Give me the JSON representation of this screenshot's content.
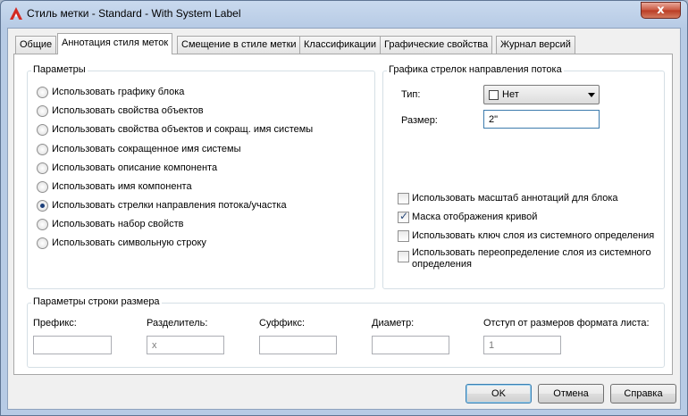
{
  "window": {
    "title": "Стиль метки - Standard - With System Label",
    "close_glyph": "x",
    "icon": "autocad-a-icon"
  },
  "tabs": [
    {
      "label": "Общие",
      "active": false
    },
    {
      "label": "Аннотация стиля меток",
      "active": true
    },
    {
      "label": "Смещение в стиле метки",
      "active": false
    },
    {
      "label": "Классификации",
      "active": false
    },
    {
      "label": "Графические свойства",
      "active": false
    },
    {
      "label": "Журнал версий",
      "active": false
    }
  ],
  "params": {
    "title": "Параметры",
    "options": [
      {
        "label": "Использовать графику блока",
        "checked": false
      },
      {
        "label": "Использовать свойства объектов",
        "checked": false
      },
      {
        "label": "Использовать свойства объектов и сокращ. имя системы",
        "checked": false
      },
      {
        "label": "Использовать сокращенное имя системы",
        "checked": false
      },
      {
        "label": "Использовать описание компонента",
        "checked": false
      },
      {
        "label": "Использовать имя компонента",
        "checked": false
      },
      {
        "label": "Использовать стрелки направления потока/участка",
        "checked": true
      },
      {
        "label": "Использовать набор свойств",
        "checked": false
      },
      {
        "label": "Использовать символьную строку",
        "checked": false
      }
    ]
  },
  "arrows": {
    "title": "Графика стрелок направления потока",
    "type_label": "Тип:",
    "type_value": "Нет",
    "type_color": "#ffffff",
    "size_label": "Размер:",
    "size_value": "2\"",
    "checks": [
      {
        "label": "Использовать масштаб аннотаций для блока",
        "checked": false
      },
      {
        "label": "Маска отображения кривой",
        "checked": true
      },
      {
        "label": "Использовать ключ слоя из системного определения",
        "checked": false
      },
      {
        "label": "Использовать переопределение слоя из системного определения",
        "checked": false
      }
    ]
  },
  "dimension": {
    "title": "Параметры строки размера",
    "fields": [
      {
        "label": "Префикс:",
        "value": "",
        "enabled": true
      },
      {
        "label": "Разделитель:",
        "value": "x",
        "enabled": false
      },
      {
        "label": "Суффикс:",
        "value": "",
        "enabled": true
      },
      {
        "label": "Диаметр:",
        "value": "",
        "enabled": true
      },
      {
        "label": "Отступ от размеров формата листа:",
        "value": "1",
        "enabled": false
      }
    ]
  },
  "buttons": {
    "ok": "OK",
    "cancel": "Отмена",
    "help": "Справка"
  },
  "colors": {
    "title_bar": "#b7cbe5",
    "close_button": "#c9563f",
    "default_button_border": "#3c7fb1"
  }
}
